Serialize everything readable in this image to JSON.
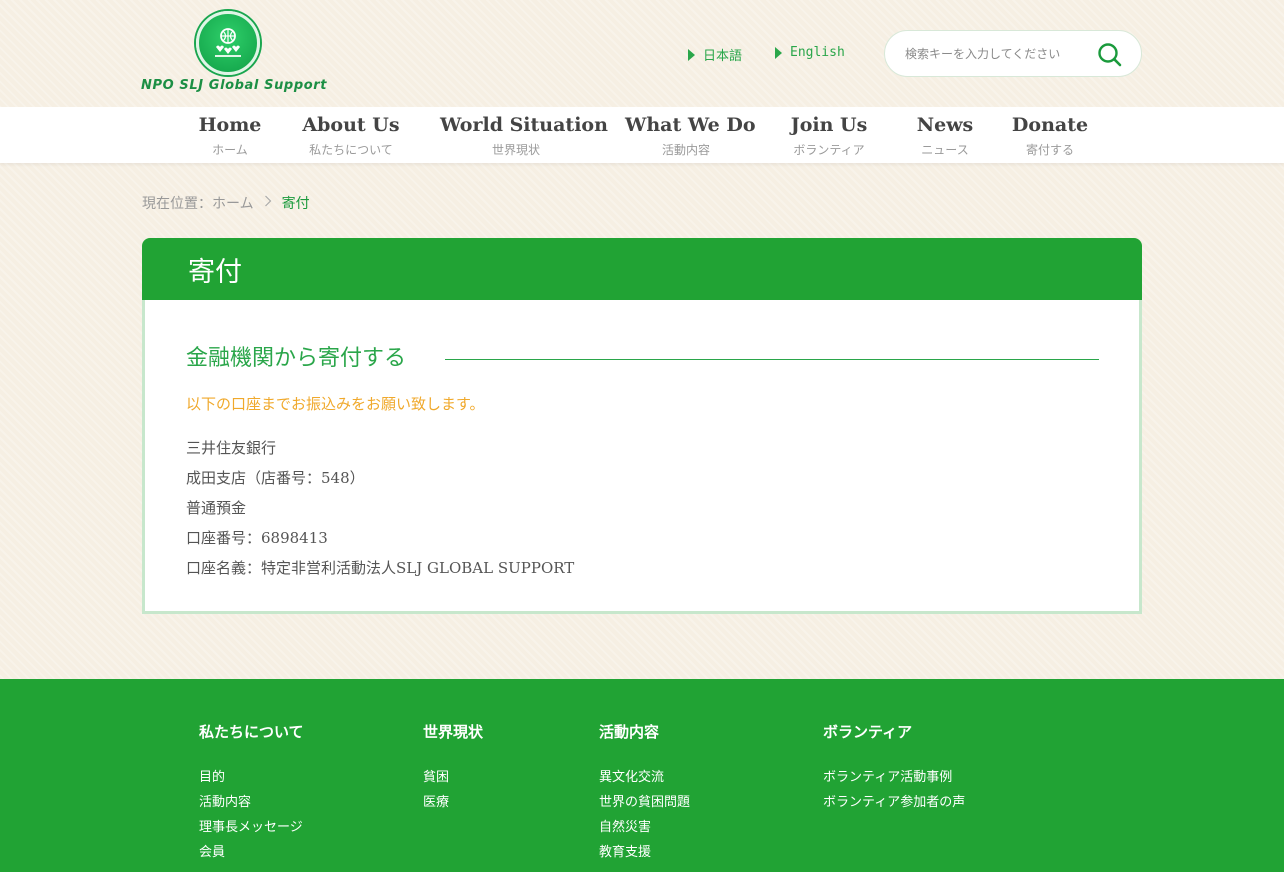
{
  "header": {
    "logo_text": "NPO SLJ Global Support",
    "languages": [
      "日本語",
      "English"
    ],
    "search_placeholder": "検索キーを入力してください"
  },
  "nav": [
    {
      "en": "Home",
      "ja": "ホーム"
    },
    {
      "en": "About Us",
      "ja": "私たちについて"
    },
    {
      "en": "World Situation",
      "ja": "世界現状"
    },
    {
      "en": "What We Do",
      "ja": "活動内容"
    },
    {
      "en": "Join Us",
      "ja": "ボランティア"
    },
    {
      "en": "News",
      "ja": "ニュース"
    },
    {
      "en": "Donate",
      "ja": "寄付する"
    }
  ],
  "breadcrumb": {
    "prefix": "現在位置：",
    "home": "ホーム",
    "current": "寄付"
  },
  "panel": {
    "title": "寄付",
    "section_title": "金融機関から寄付する",
    "notice": "以下の口座までお振込みをお願い致します。",
    "lines": [
      "三井住友銀行",
      "成田支店（店番号：548）",
      "普通預金",
      "口座番号：6898413",
      "口座名義：特定非営利活動法人SLJ GLOBAL SUPPORT"
    ]
  },
  "footer": {
    "columns": [
      {
        "title": "私たちについて",
        "links": [
          "目的",
          "活動内容",
          "理事長メッセージ",
          "会員"
        ]
      },
      {
        "title": "世界現状",
        "links": [
          "貧困",
          "医療"
        ]
      },
      {
        "title": "活動内容",
        "links": [
          "異文化交流",
          "世界の貧困問題",
          "自然災害",
          "教育支援"
        ]
      },
      {
        "title": "ボランティア",
        "links": [
          "ボランティア活動事例",
          "ボランティア参加者の声"
        ]
      }
    ]
  },
  "colors": {
    "brand_green": "#21a334",
    "accent_orange": "#f0a92c",
    "background": "#f6efe3"
  },
  "icons": {
    "logo": "globe-hearts-icon",
    "search": "search-icon",
    "language_marker": "triangle-right-icon",
    "breadcrumb_separator": "chevron-right-icon"
  }
}
